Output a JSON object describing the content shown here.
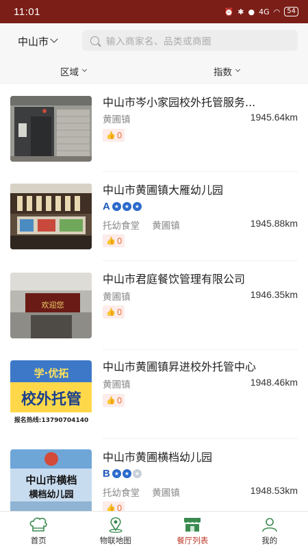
{
  "status_bar": {
    "time": "11:01",
    "battery": "54",
    "network": "4G"
  },
  "header": {
    "city": "中山市",
    "search_placeholder": "输入商家名、品类或商圈"
  },
  "filters": {
    "area": "区域",
    "index": "指数"
  },
  "restaurants": [
    {
      "name": "中山市岑小家园校外托管服务...",
      "category": "",
      "town": "黄圃镇",
      "distance": "1945.64km",
      "likes": "0",
      "rating": ""
    },
    {
      "name": "中山市黄圃镇大雁幼儿园",
      "category": "托幼食堂",
      "town": "黄圃镇",
      "distance": "1945.88km",
      "likes": "0",
      "rating": "A",
      "rating_stars": 3
    },
    {
      "name": "中山市君庭餐饮管理有限公司",
      "category": "",
      "town": "黄圃镇",
      "distance": "1946.35km",
      "likes": "0",
      "rating": ""
    },
    {
      "name": "中山市黄圃镇昇进校外托管中心",
      "category": "",
      "town": "黄圃镇",
      "distance": "1948.46km",
      "likes": "0",
      "rating": ""
    },
    {
      "name": "中山市黄圃横档幼儿园",
      "category": "托幼食堂",
      "town": "黄圃镇",
      "distance": "1948.53km",
      "likes": "0",
      "rating": "B",
      "rating_stars": 2
    }
  ],
  "thumb_texts": {
    "t2": "欢迎您",
    "t3_line1": "学·优拓",
    "t3_line2": "校外托管",
    "t3_line3": "报名热线:13790704140",
    "t4_line1": "中山市横档",
    "t4_line2": "横档幼儿园"
  },
  "tabbar": [
    {
      "label": "首页",
      "icon": "chef-hat-icon"
    },
    {
      "label": "物联地图",
      "icon": "map-pin-icon"
    },
    {
      "label": "餐厅列表",
      "icon": "storefront-icon",
      "active": true
    },
    {
      "label": "我的",
      "icon": "user-icon"
    }
  ],
  "colors": {
    "status_bar": "#7a1e17",
    "accent": "#c0392b",
    "likes_bg": "#fdecea",
    "likes_fg": "#e8743b",
    "rating_blue": "#1e58b8",
    "tab_green": "#3a8a4f"
  }
}
